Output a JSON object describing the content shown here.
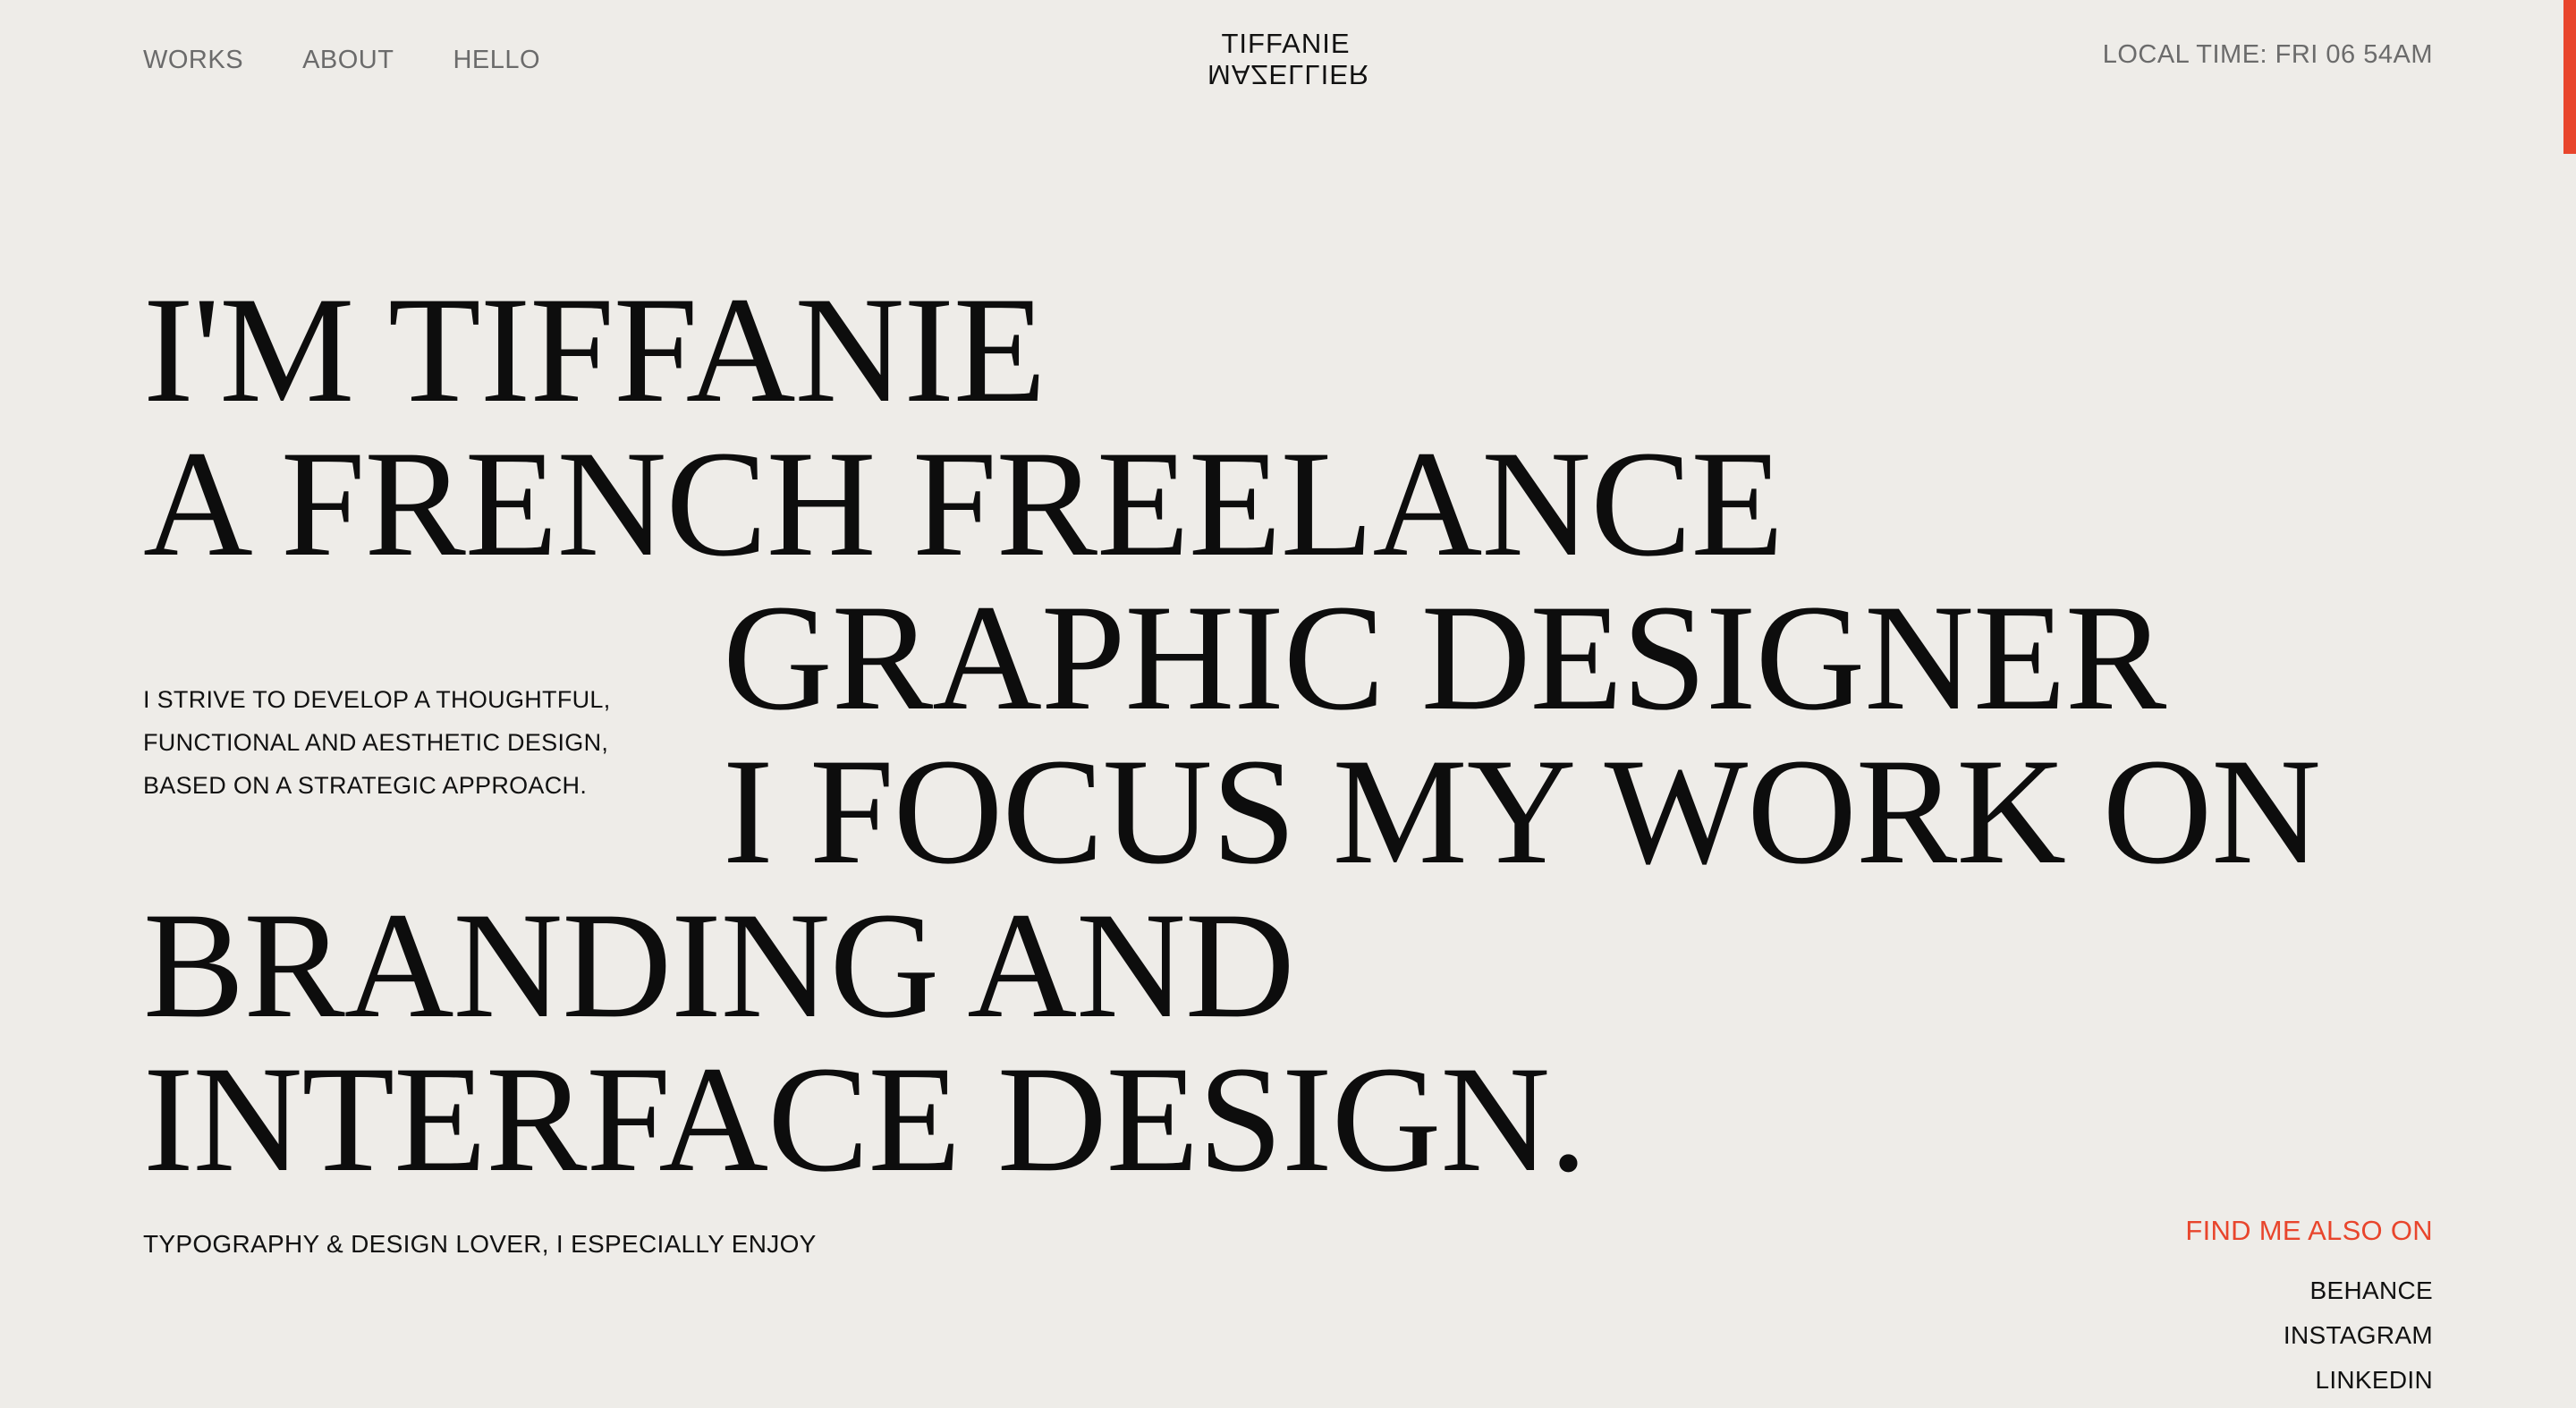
{
  "nav": {
    "items": [
      "WORKS",
      "ABOUT",
      "HELLO"
    ]
  },
  "logo": {
    "line1": "TIFFANIE",
    "line2": "MAZELLIER"
  },
  "header": {
    "local_time": "LOCAL TIME: FRI 06 54AM"
  },
  "hero": {
    "lines": [
      "I'M TIFFANIE",
      "A FRENCH FREELANCE",
      "GRAPHIC DESIGNER",
      "I FOCUS MY WORK ON",
      "BRANDING AND",
      "INTERFACE DESIGN."
    ]
  },
  "intro": {
    "lines": [
      "I STRIVE TO DEVELOP A THOUGHTFUL,",
      "FUNCTIONAL AND AESTHETIC DESIGN,",
      "BASED ON A STRATEGIC APPROACH."
    ]
  },
  "tagline": "TYPOGRAPHY & DESIGN LOVER, I ESPECIALLY ENJOY",
  "social": {
    "title": "FIND ME ALSO ON",
    "links": [
      "BEHANCE",
      "INSTAGRAM",
      "LINKEDIN"
    ]
  },
  "colors": {
    "background": "#EEECE8",
    "accent": "#E8452C",
    "text": "#111111",
    "muted": "#6B6B6B"
  }
}
